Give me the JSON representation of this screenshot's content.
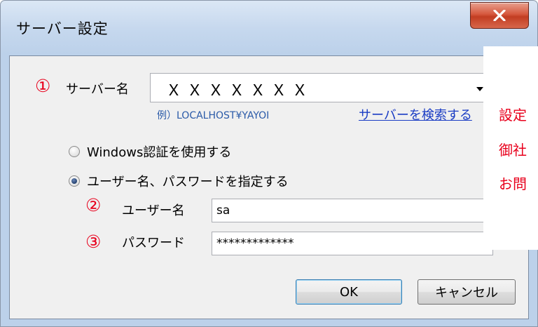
{
  "window": {
    "title": "サーバー設定",
    "close_label": "X"
  },
  "annotations": {
    "n1": "①",
    "n2": "②",
    "n3": "③"
  },
  "server": {
    "label": "サーバー名",
    "value": "ＸＸＸＸＸＸＸ",
    "example": "例）LOCALHOST¥YAYOI",
    "search_link": "サーバーを検索する"
  },
  "auth": {
    "windows_label": "Windows認証を使用する",
    "windows_checked": false,
    "user_label": "ユーザー名、パスワードを指定する",
    "user_checked": true
  },
  "credentials": {
    "username_label": "ユーザー名",
    "username_value": "sa",
    "password_label": "パスワード",
    "password_value": "*************"
  },
  "buttons": {
    "ok": "OK",
    "cancel": "キャンセル"
  },
  "side_note": {
    "line1": "設定",
    "line2": "御社",
    "line3": "お問"
  },
  "colors": {
    "annotation": "#e8001c",
    "link": "#1a3cc4"
  }
}
